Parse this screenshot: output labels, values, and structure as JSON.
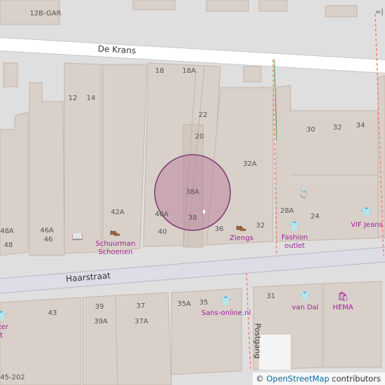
{
  "map": {
    "streets": {
      "de_krans": "De Krans",
      "haarstraat": "Haarstraat",
      "postgang": "Postgang"
    },
    "house_numbers": {
      "n12b_gar": "12B-GAR",
      "n18": "18",
      "n18a": "18A",
      "n12": "12",
      "n14": "14",
      "n22": "22",
      "n20": "20",
      "n30": "30",
      "n32_top": "32",
      "n34": "34",
      "n32a": "32A",
      "n38a": "38A",
      "n42a": "42A",
      "n40a": "40A",
      "n40": "40",
      "n38": "38",
      "n36": "36",
      "n32": "32",
      "n28a": "28A",
      "n24": "24",
      "n48a": "48A",
      "n48": "48",
      "n46a": "46A",
      "n46": "46",
      "n43": "43",
      "n39": "39",
      "n39a": "39A",
      "n37": "37",
      "n37a": "37A",
      "n35a": "35A",
      "n35": "35",
      "n31": "31",
      "n45_202": "45-202"
    },
    "pois": {
      "schuurman_line1": "Schuurman",
      "schuurman_line2": "Schoenen",
      "ziengs": "Ziengs",
      "fashion_line1": "Fashion",
      "fashion_line2": "outlet",
      "vif_jeans": "VIF Jeans",
      "sans_online": "Sans-online.nl",
      "van_dal": "van Dal",
      "hema": "HEMA",
      "partial_line1": "ker",
      "partial_line2": "rt"
    },
    "icons": {
      "book": "book-icon",
      "shoe": "shoe-icon",
      "shirt": "shirt-icon",
      "jewel": "jewelry-icon",
      "bag": "shopping-bag-icon"
    },
    "colors": {
      "background": "#e0dfdf",
      "building": "#d9d0c9",
      "building_outline": "#c4b6ab",
      "road": "#ffffff",
      "pedestrian_street": "#dddde8",
      "poi": "#a1239a",
      "marker_fill": "#b5789a",
      "marker_stroke": "#7a3a72",
      "path": "#fa8072"
    }
  },
  "attribution": {
    "prefix": "© ",
    "link": "OpenStreetMap",
    "suffix": " contributors"
  }
}
